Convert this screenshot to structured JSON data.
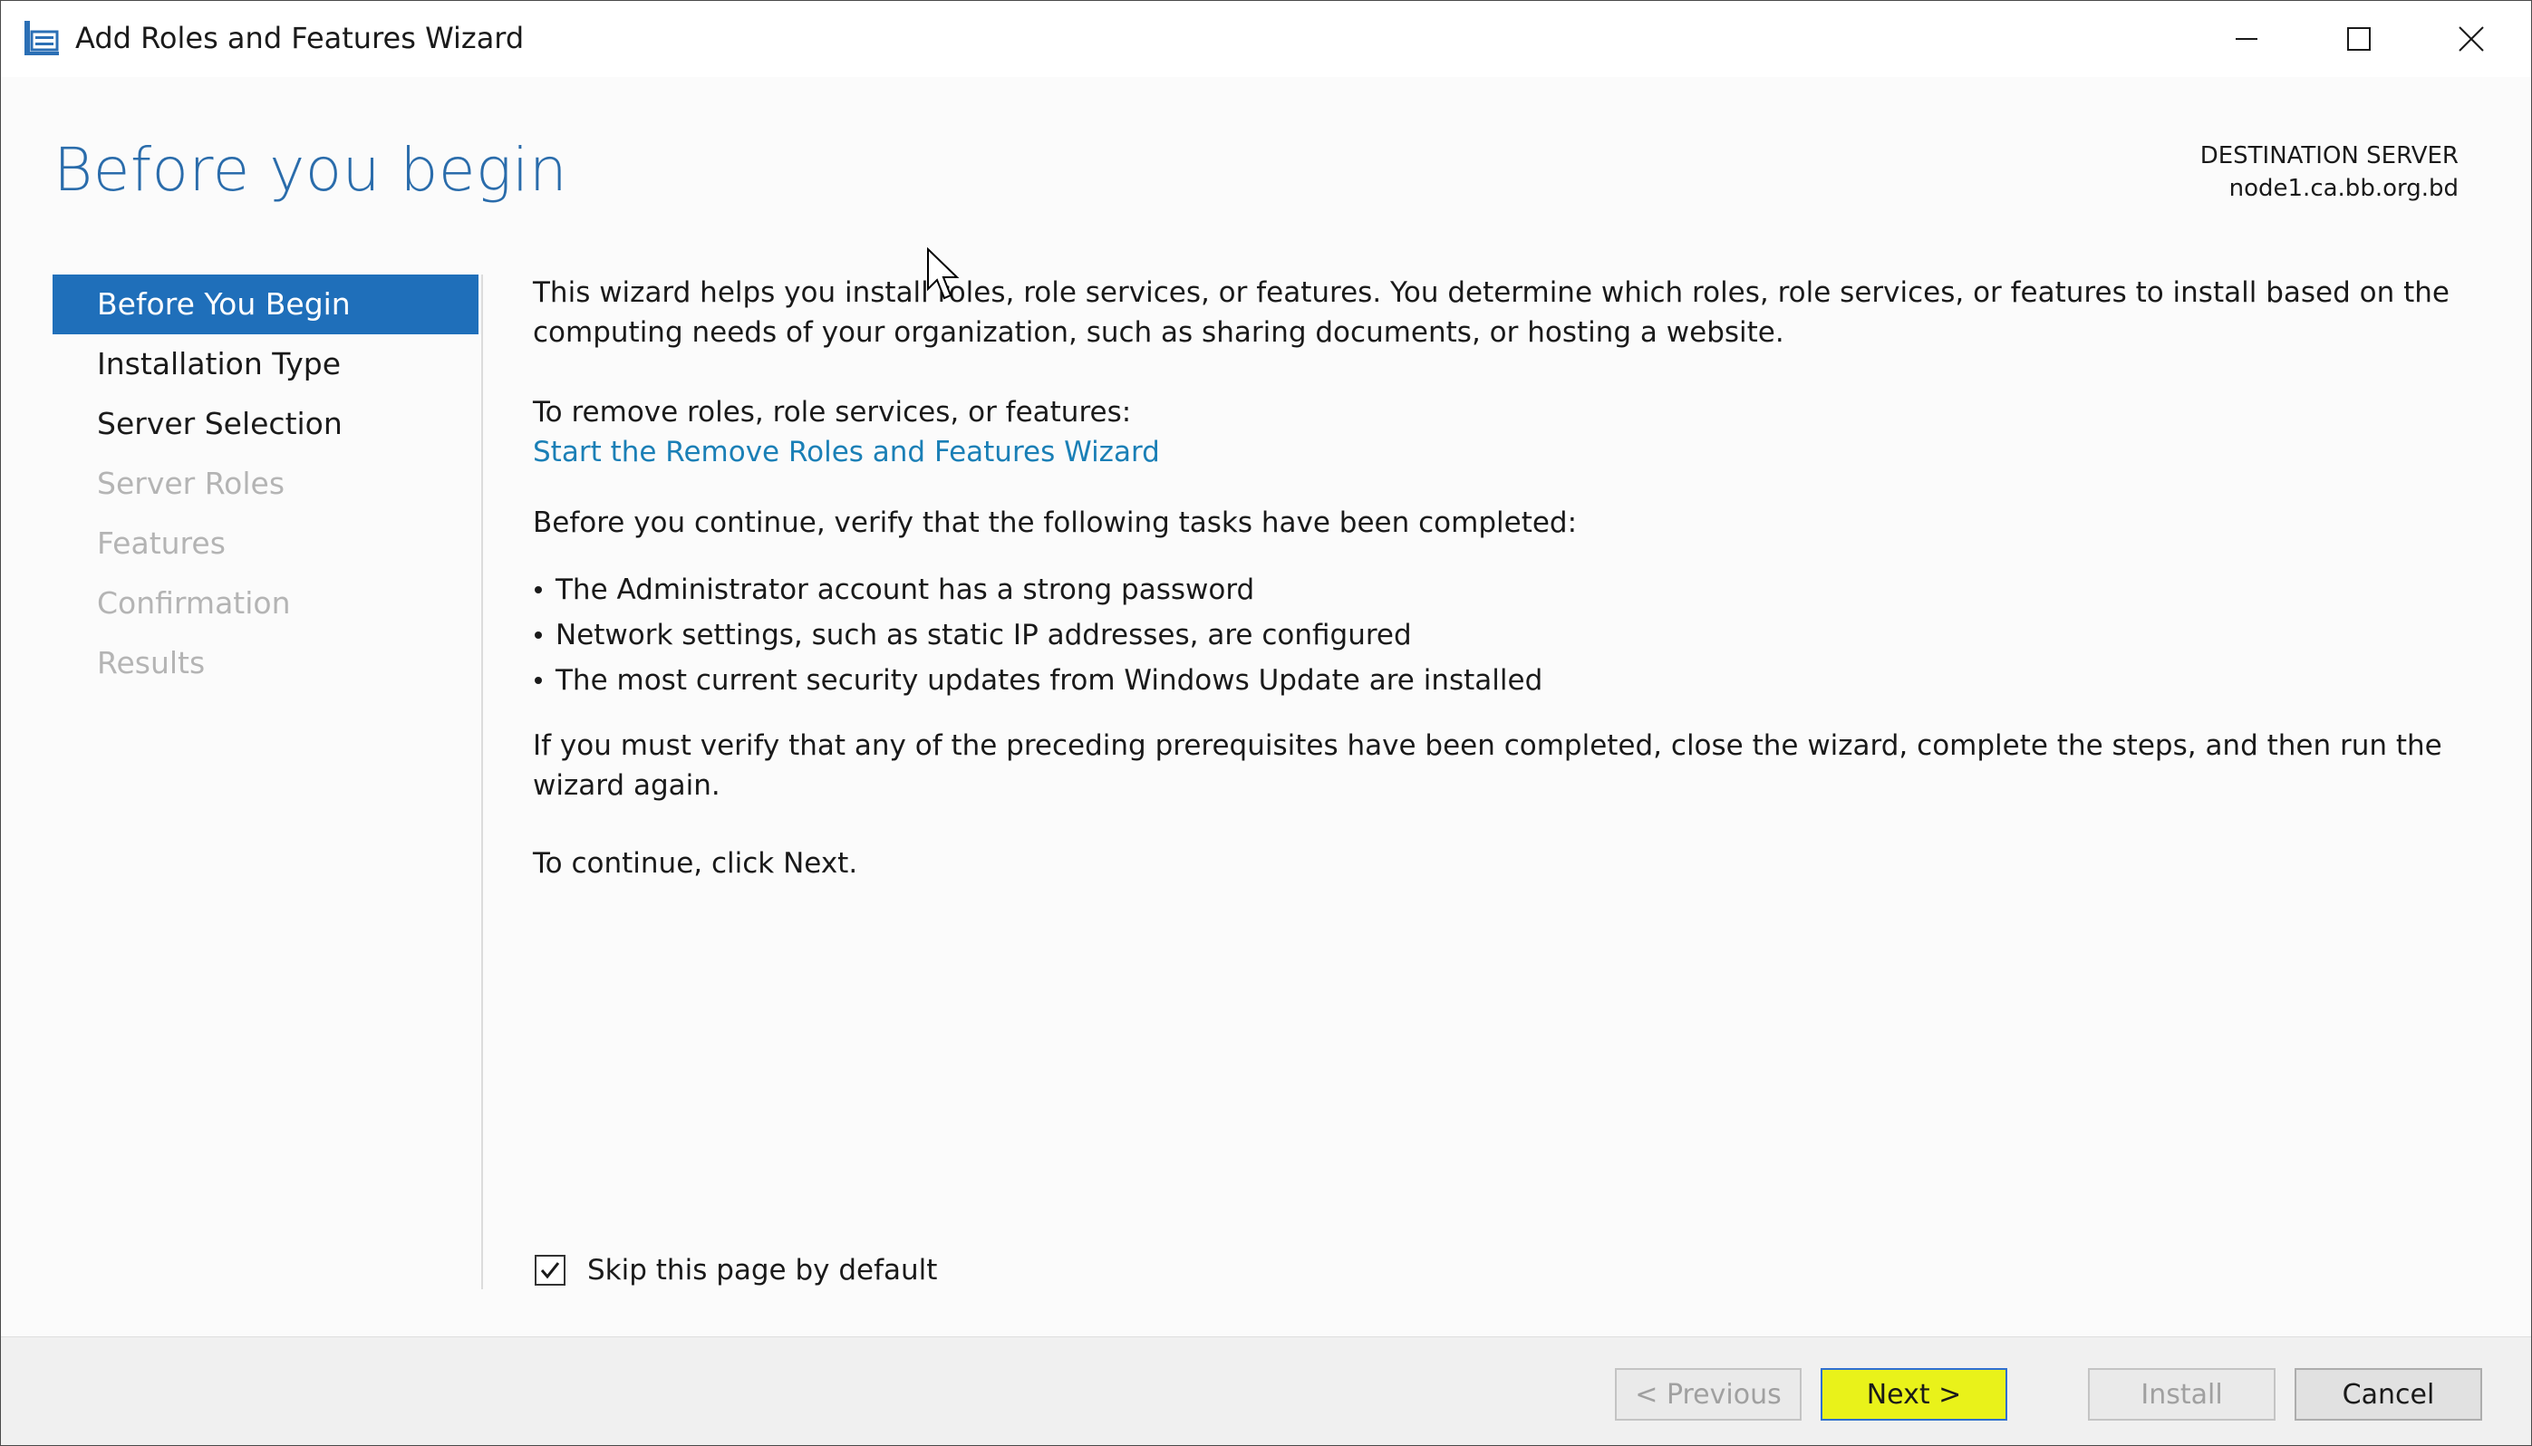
{
  "window": {
    "title": "Add Roles and Features Wizard"
  },
  "header": {
    "page_title": "Before you begin",
    "destination_label": "DESTINATION SERVER",
    "destination_value": "node1.ca.bb.org.bd"
  },
  "nav": {
    "items": [
      {
        "label": "Before You Begin",
        "state": "active"
      },
      {
        "label": "Installation Type",
        "state": "enabled"
      },
      {
        "label": "Server Selection",
        "state": "enabled"
      },
      {
        "label": "Server Roles",
        "state": "disabled"
      },
      {
        "label": "Features",
        "state": "disabled"
      },
      {
        "label": "Confirmation",
        "state": "disabled"
      },
      {
        "label": "Results",
        "state": "disabled"
      }
    ]
  },
  "content": {
    "intro": "This wizard helps you install roles, role services, or features. You determine which roles, role services, or features to install based on the computing needs of your organization, such as sharing documents, or hosting a website.",
    "remove_label": "To remove roles, role services, or features:",
    "remove_link": "Start the Remove Roles and Features Wizard",
    "before_continue": "Before you continue, verify that the following tasks have been completed:",
    "tasks": [
      "The Administrator account has a strong password",
      "Network settings, such as static IP addresses, are configured",
      "The most current security updates from Windows Update are installed"
    ],
    "verify": "If you must verify that any of the preceding prerequisites have been completed, close the wizard, complete the steps, and then run the wizard again.",
    "continue": "To continue, click Next."
  },
  "skip": {
    "label": "Skip this page by default",
    "checked": true
  },
  "footer": {
    "previous_label": "< Previous",
    "next_label": "Next >",
    "install_label": "Install",
    "cancel_label": "Cancel"
  },
  "colors": {
    "accent": "#1f6fba",
    "title": "#2a6cab",
    "link": "#1a7fb6",
    "highlight": "#e9f21a"
  }
}
